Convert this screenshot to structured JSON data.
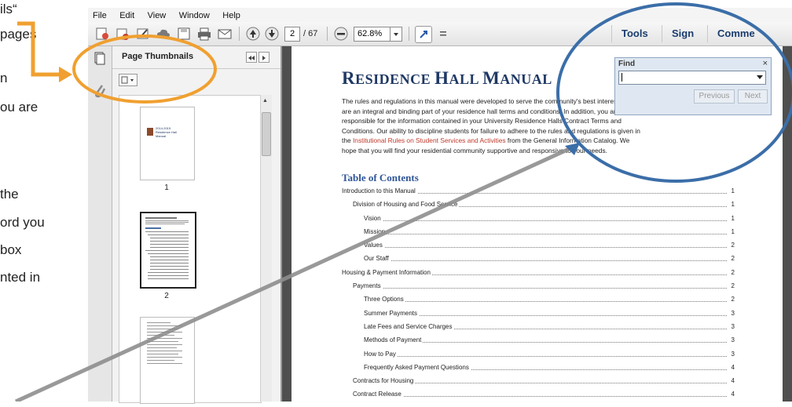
{
  "instructions": {
    "lines": [
      "ils“",
      "pages",
      "n",
      "ou are",
      "the",
      "ord you",
      "box",
      "nted in"
    ]
  },
  "menu": [
    "File",
    "Edit",
    "View",
    "Window",
    "Help"
  ],
  "toolbar": {
    "current_page": "2",
    "total_pages": "/ 67",
    "zoom": "62.8%",
    "tools_label": "Tools",
    "sign_label": "Sign",
    "comment_label": "Comme"
  },
  "panel": {
    "title": "Page Thumbnails",
    "thumbnails": [
      {
        "number": "1",
        "heading": [
          "2014-2015",
          "Residence Hall",
          "Manual"
        ]
      },
      {
        "number": "2"
      },
      {
        "number": ""
      }
    ]
  },
  "find": {
    "title": "Find",
    "close": "×",
    "previous_label": "Previous",
    "next_label": "Next"
  },
  "document": {
    "title_big1": "R",
    "title_small1": "ESIDENCE ",
    "title_big2": "H",
    "title_small2": "ALL ",
    "title_big3": "M",
    "title_small3": "ANUAL",
    "intro_1": "The rules and regulations in this manual were developed to serve the community's best interests and",
    "intro_2": "are an integral and binding part of your residence hall terms and conditions. In addition, you are",
    "intro_3": "responsible for the information contained in your University Residence Halls Contract Terms and",
    "intro_4": "Conditions. Our ability to discipline students for failure to adhere to the rules and regulations is given in",
    "intro_5a": "the ",
    "intro_5_link": "Institutional Rules on Student Services and Activities",
    "intro_5b": " from the General Information Catalog. We",
    "intro_6": "hope that you will find your residential community supportive and responsive to your needs.",
    "toc_title": "Table of Contents",
    "toc": [
      {
        "text": "Introduction to this Manual",
        "page": "1",
        "level": 0
      },
      {
        "text": "Division of Housing and Food Service",
        "page": "1",
        "level": 1
      },
      {
        "text": "Vision",
        "page": "1",
        "level": 2
      },
      {
        "text": "Mission",
        "page": "1",
        "level": 2
      },
      {
        "text": "Values",
        "page": "2",
        "level": 2
      },
      {
        "text": "Our Staff",
        "page": "2",
        "level": 2
      },
      {
        "text": "Housing & Payment Information",
        "page": "2",
        "level": 0
      },
      {
        "text": "Payments",
        "page": "2",
        "level": 1
      },
      {
        "text": "Three Options",
        "page": "2",
        "level": 2
      },
      {
        "text": "Summer Payments",
        "page": "3",
        "level": 2
      },
      {
        "text": "Late Fees and Service Charges",
        "page": "3",
        "level": 2
      },
      {
        "text": "Methods of Payment",
        "page": "3",
        "level": 2
      },
      {
        "text": "How to Pay",
        "page": "3",
        "level": 2
      },
      {
        "text": "Frequently Asked Payment Questions",
        "page": "4",
        "level": 2
      },
      {
        "text": "Contracts for Housing",
        "page": "4",
        "level": 1
      },
      {
        "text": "Contract Release",
        "page": "4",
        "level": 1
      }
    ]
  },
  "colors": {
    "highlight_orange": "#f0a030",
    "highlight_blue": "#3b6ea8"
  }
}
